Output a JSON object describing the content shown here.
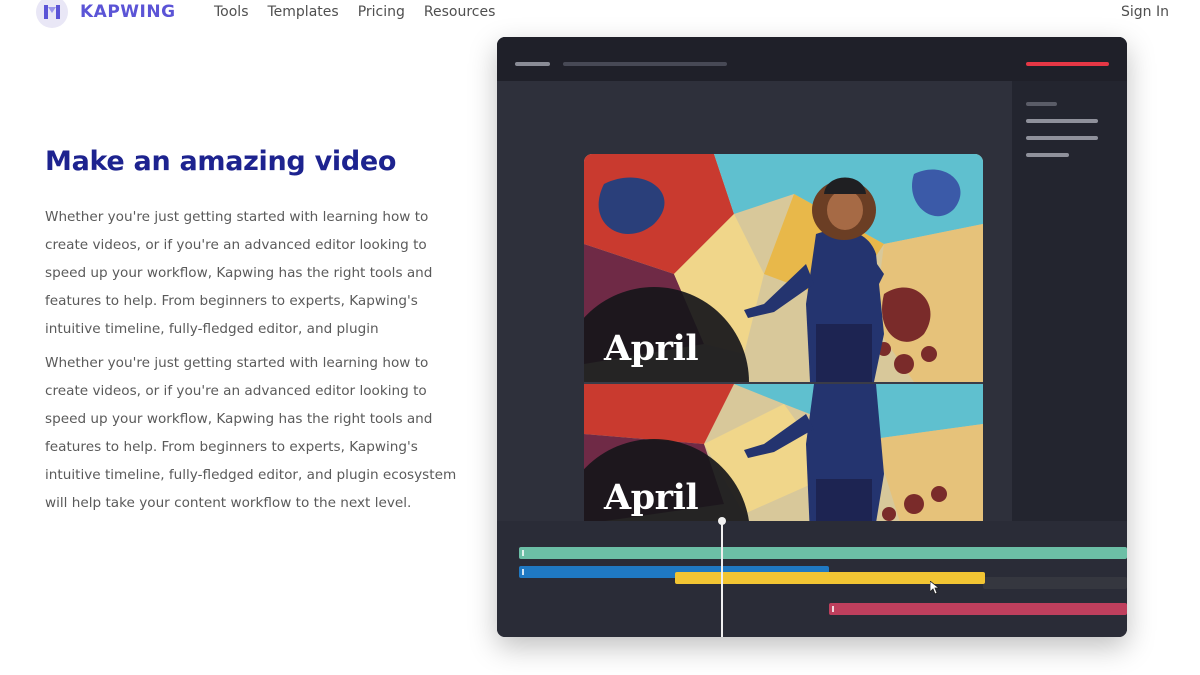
{
  "header": {
    "brand": "KAPWING",
    "nav": [
      "Tools",
      "Templates",
      "Pricing",
      "Resources"
    ],
    "signin": "Sign In"
  },
  "hero": {
    "title": "Make an amazing video",
    "paragraphs": [
      "Whether you're just getting started with learning how to create videos, or if you're an advanced editor looking to speed up your workflow, Kapwing has the right tools and features to help. From beginners to experts, Kapwing's intuitive timeline, fully-fledged editor, and plugin",
      "Whether you're just getting started with learning how to create videos, or if you're an advanced editor looking to speed up your workflow, Kapwing has the right tools and features to help. From beginners to experts, Kapwing's intuitive timeline, fully-fledged editor, and plugin ecosystem will help take your content workflow to the next level."
    ]
  },
  "editor": {
    "caption_top": "April",
    "caption_bottom": "April",
    "colors": {
      "accent_red": "#e53745",
      "track_green": "#6cbfa6",
      "track_blue": "#1f79c3",
      "track_yellow": "#f2c533",
      "track_pink": "#bf3f5d"
    },
    "icons": [
      "kapwing-logo-icon",
      "mouse-cursor-icon"
    ]
  }
}
